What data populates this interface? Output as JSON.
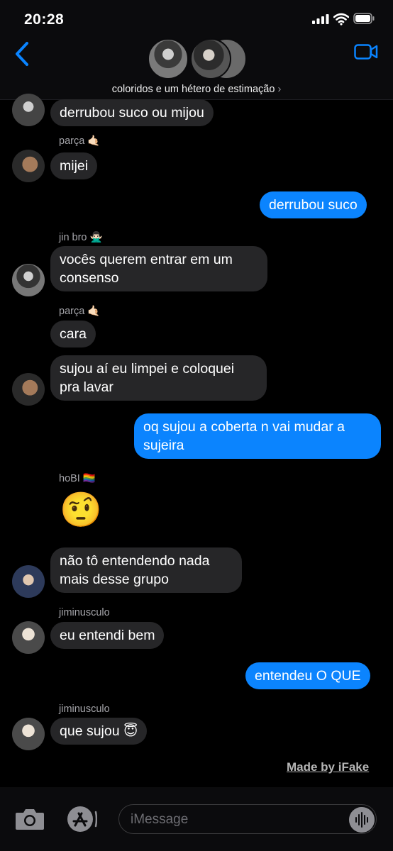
{
  "status_bar": {
    "time": "20:28"
  },
  "header": {
    "group_name": "coloridos e um hétero de estimação",
    "chevron": "›"
  },
  "messages": [
    {
      "text": "derrubou suco ou mijou"
    },
    {
      "sender": "parça",
      "sender_emoji": "🤙🏻",
      "text": "mijei"
    },
    {
      "text": "derrubou suco"
    },
    {
      "sender": "jin bro",
      "sender_emoji": "🙅🏻‍♂️",
      "line1": "vocês querem entrar em um",
      "line2": "consenso"
    },
    {
      "sender": "parça",
      "sender_emoji": "🤙🏻",
      "text": "cara"
    },
    {
      "line1": "sujou aí eu limpei e coloquei",
      "line2": "pra lavar"
    },
    {
      "line1": "oq sujou a coberta n vai mudar a",
      "line2": "sujeira"
    },
    {
      "sender": "hoBI",
      "sender_emoji": "🏳️‍🌈",
      "emoji": "🤨"
    },
    {
      "line1": "não tô entendendo nada",
      "line2": "mais desse grupo"
    },
    {
      "sender": "jiminusculo",
      "text": "eu entendi bem"
    },
    {
      "text": "entendeu O QUE"
    },
    {
      "sender": "jiminusculo",
      "text": "que sujou 😇"
    }
  ],
  "watermark": "Made by iFake",
  "composer": {
    "placeholder": "iMessage"
  },
  "icons": [
    "back-chevron-icon",
    "video-camera-icon",
    "camera-icon",
    "app-store-icon",
    "audio-waveform-icon",
    "signal-icon",
    "wifi-icon",
    "battery-icon"
  ],
  "colors": {
    "outgoing": "#0b84fe",
    "incoming": "#262628",
    "background": "#000000"
  }
}
